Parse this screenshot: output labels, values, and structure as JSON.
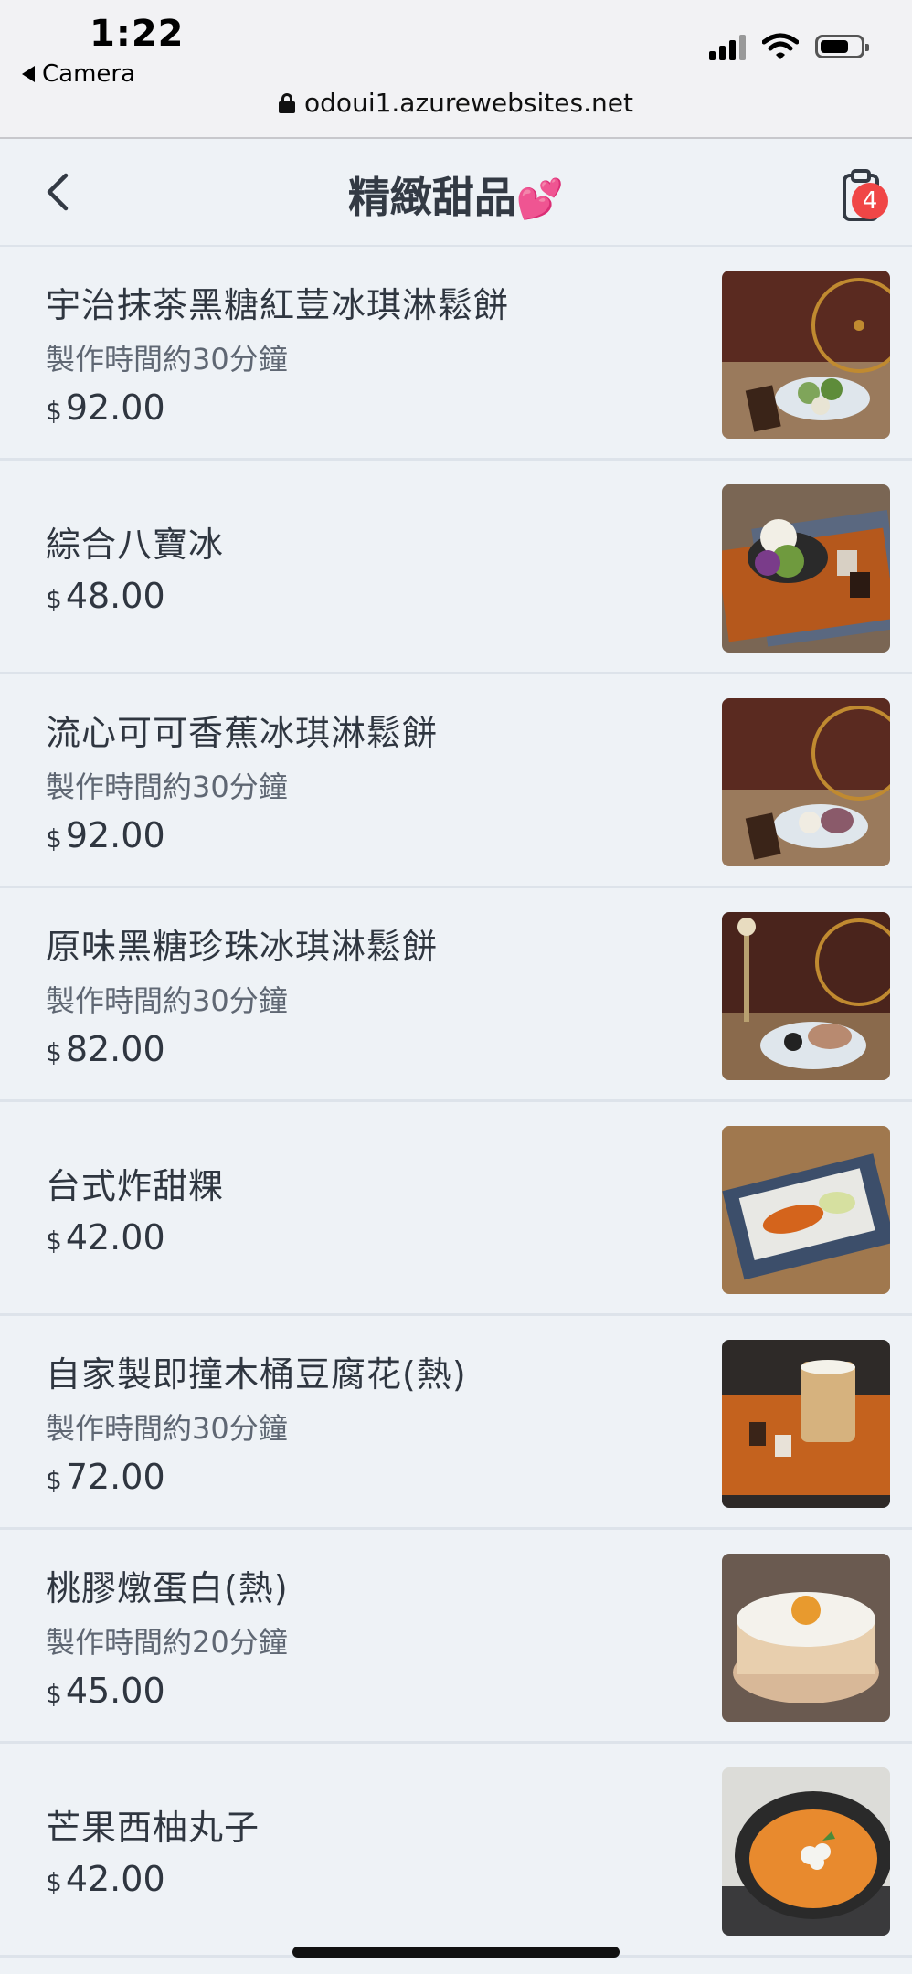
{
  "status_bar": {
    "time": "1:22",
    "back_app": "Camera",
    "url": "odoui1.azurewebsites.net"
  },
  "header": {
    "title": "精緻甜品",
    "title_emoji": "💕",
    "cart_count": "4"
  },
  "items": [
    {
      "name": "宇治抹茶黑糖紅荳冰琪淋鬆餅",
      "note": "製作時間約30分鐘",
      "currency": "$",
      "price": "92.00"
    },
    {
      "name": "綜合八寶冰",
      "note": "",
      "currency": "$",
      "price": "48.00"
    },
    {
      "name": "流心可可香蕉冰琪淋鬆餅",
      "note": "製作時間約30分鐘",
      "currency": "$",
      "price": "92.00"
    },
    {
      "name": "原味黑糖珍珠冰琪淋鬆餅",
      "note": "製作時間約30分鐘",
      "currency": "$",
      "price": "82.00"
    },
    {
      "name": "台式炸甜粿",
      "note": "",
      "currency": "$",
      "price": "42.00"
    },
    {
      "name": "自家製即撞木桶豆腐花(熱)",
      "note": "製作時間約30分鐘",
      "currency": "$",
      "price": "72.00"
    },
    {
      "name": "桃膠燉蛋白(熱)",
      "note": "製作時間約20分鐘",
      "currency": "$",
      "price": "45.00"
    },
    {
      "name": "芒果西柚丸子",
      "note": "",
      "currency": "$",
      "price": "42.00"
    }
  ],
  "colors": {
    "background": "#eef2f6",
    "badge": "#f04646",
    "text": "#2f3640",
    "muted": "#5f6773"
  },
  "icons": {
    "back": "chevron-left-icon",
    "cart": "clipboard-icon"
  }
}
